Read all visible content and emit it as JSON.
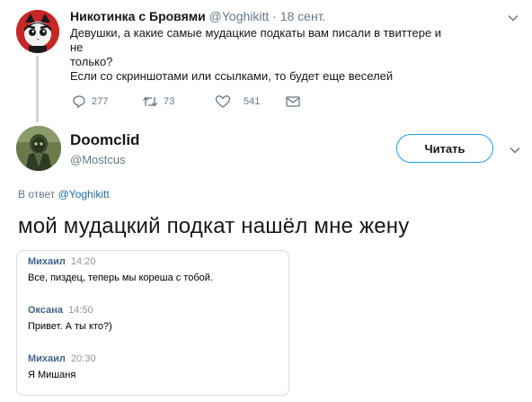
{
  "parent_tweet": {
    "author_name": "Никотинка с Бровями",
    "handle": "@Yoghikitt",
    "date": "18 сент.",
    "text_lines": [
      "Девушки, а какие самые мудацкие подкаты вам писали в твиттере и не",
      "только?",
      "Если со скриншотами или ссылками, то будет еще веселей"
    ],
    "actions": {
      "replies": "277",
      "retweets": "73",
      "likes": "541"
    }
  },
  "main_tweet": {
    "author_name": "Doomclid",
    "handle": "@Mostcus",
    "follow_label": "Читать",
    "reply_prefix": "В ответ",
    "reply_handle": "@Yoghikitt",
    "text": "мой мудацкий подкат нашёл мне жену"
  },
  "chat_screenshot": {
    "messages": [
      {
        "author": "Михаил",
        "time": "14:20",
        "text": "Все, пиздец, теперь мы кореша с тобой."
      },
      {
        "author": "Оксана",
        "time": "14:50",
        "text": "Привет. А ты кто?)"
      },
      {
        "author": "Михаил",
        "time": "20:30",
        "text": "Я Мишаня"
      }
    ]
  },
  "icons": {
    "reply": "reply-icon",
    "retweet": "retweet-icon",
    "like": "heart-icon",
    "dm": "envelope-icon",
    "menu": "chevron-down-icon"
  },
  "colors": {
    "accent": "#1da1f2",
    "secondary_text": "#657786",
    "chat_author": "#42648b"
  }
}
